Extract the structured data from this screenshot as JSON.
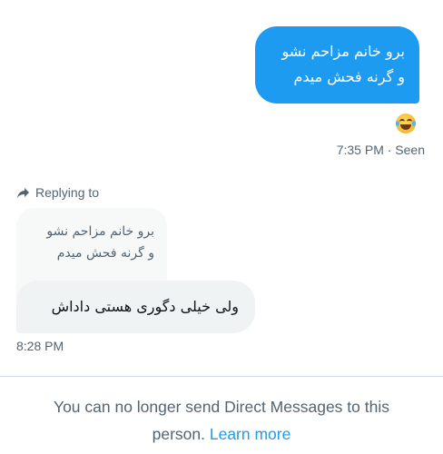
{
  "outgoing_message": {
    "lines": [
      "برو خانم مزاحم نشو",
      "و گرنه فحش میدم"
    ],
    "reaction_icon": "laughing-tears-emoji",
    "meta": "7:35 PM · Seen"
  },
  "reply": {
    "label": "Replying to",
    "quoted_lines": [
      "برو خانم مزاحم نشو",
      "و گرنه فحش میدم"
    ],
    "message": "ولی خیلی دگوری هستی داداش",
    "time": "8:28 PM"
  },
  "footer": {
    "notice_line1": "You can no longer send Direct Messages to this",
    "notice_line2_prefix": "person. ",
    "learn_more": "Learn more"
  },
  "colors": {
    "accent": "#1d9bf0",
    "muted_text": "#536471",
    "incoming_bubble": "#eff3f4"
  }
}
